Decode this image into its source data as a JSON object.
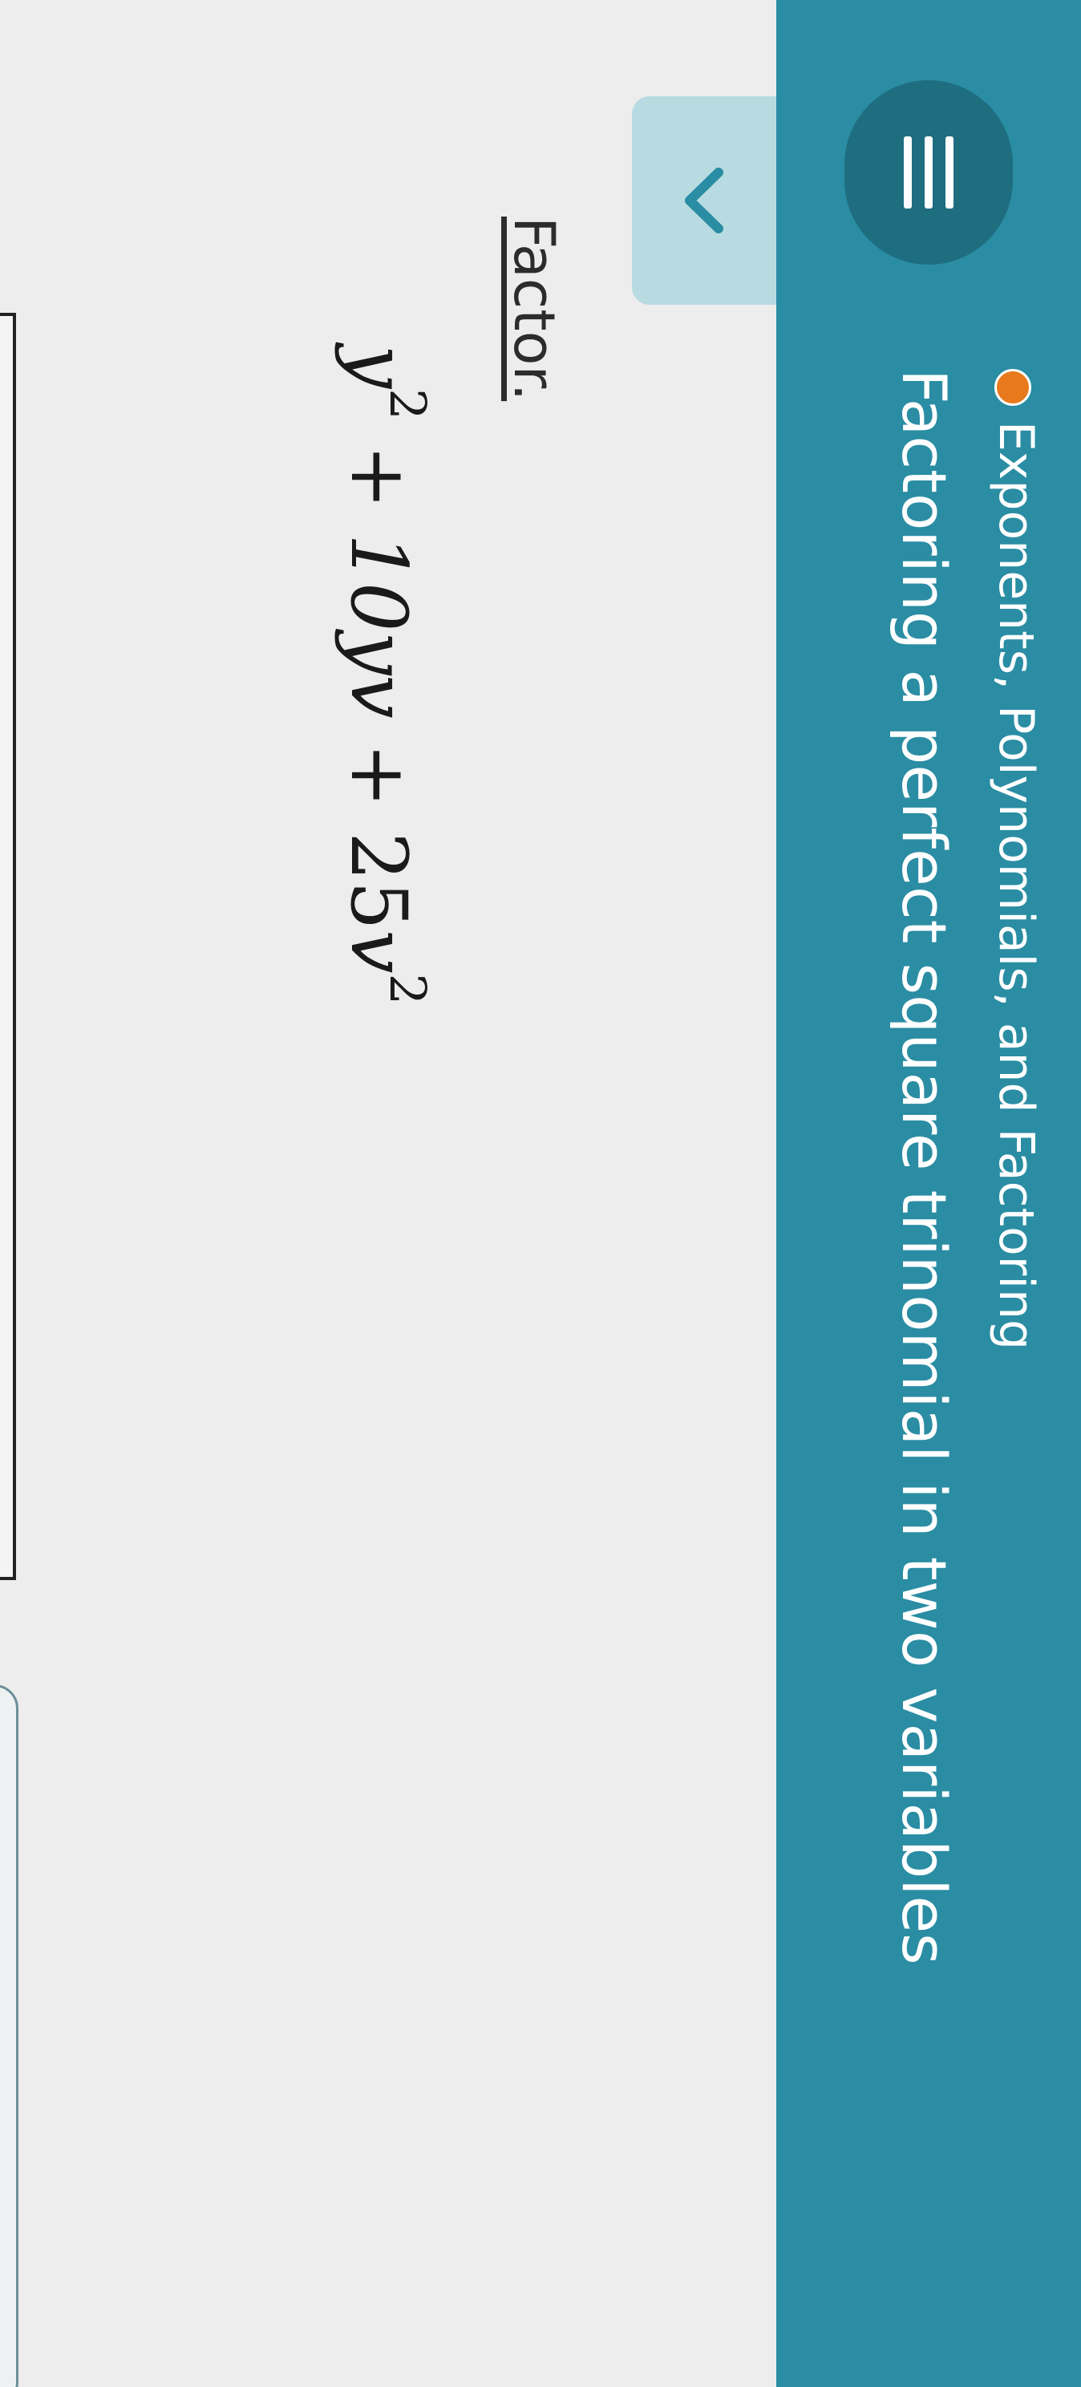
{
  "header": {
    "category": "Exponents, Polynomials, and Factoring",
    "title": "Factoring a perfect square trinomial in two variables",
    "accent_color": "#2a8da3",
    "status_color": "#e8791c",
    "menu_icon": "hamburger-menu-icon",
    "collapse_icon": "chevron-down-icon"
  },
  "problem": {
    "prompt": "Factor.",
    "expression": {
      "term1_var": "y",
      "term1_exp": "2",
      "op1": "+",
      "term2": "10yv",
      "op2": "+",
      "term3_coef": "25",
      "term3_var": "v",
      "term3_exp": "2"
    }
  },
  "answer": {
    "value": ""
  }
}
